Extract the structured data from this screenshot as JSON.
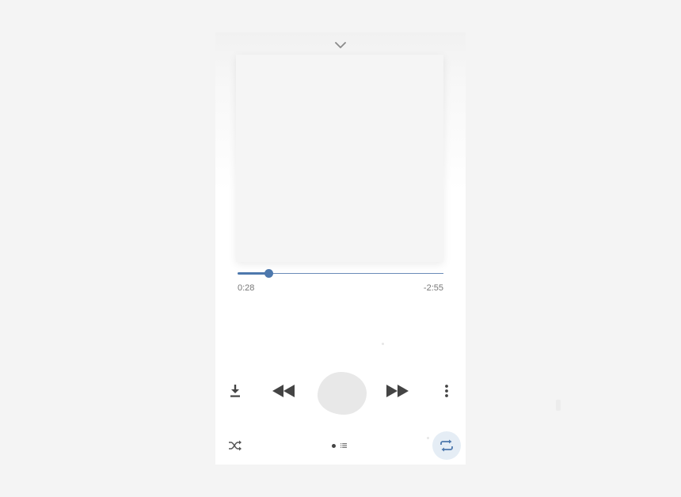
{
  "player": {
    "icons": {
      "collapse": "chevron-down-icon",
      "download": "download-icon",
      "rewind": "rewind-icon",
      "play": "play-pause-icon",
      "forward": "fast-forward-icon",
      "more": "more-vertical-icon",
      "shuffle": "shuffle-icon",
      "repeat": "repeat-icon",
      "queue": "queue-list-icon"
    },
    "progress": {
      "fraction": 0.15,
      "elapsed": "0:28",
      "remaining": "-2:55"
    },
    "pager": {
      "active_index": 0
    },
    "colors": {
      "accent": "#4d78ad",
      "icon": "#444444",
      "repeat_active_bg": "#e5edf5"
    }
  }
}
